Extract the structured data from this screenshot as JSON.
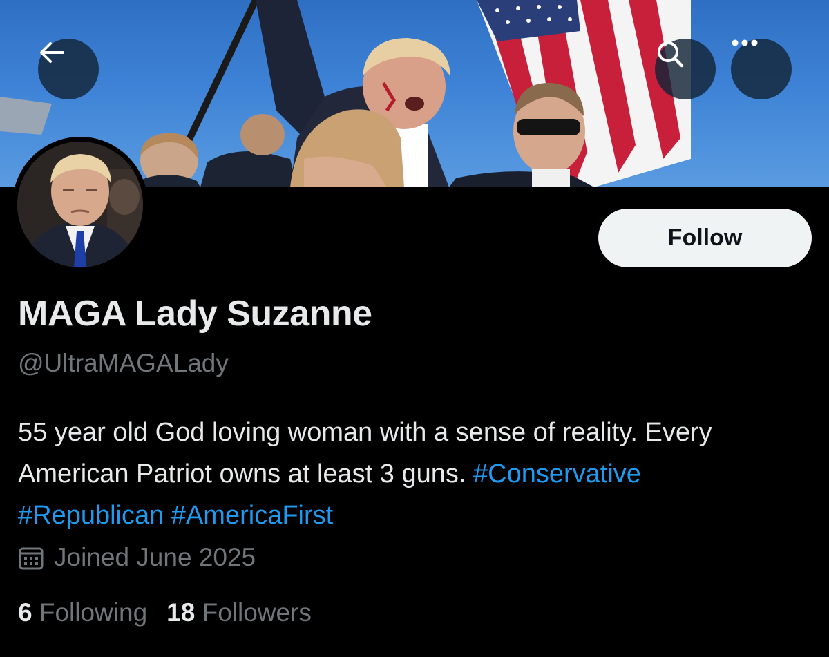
{
  "header": {
    "back_icon": "arrow-left-icon",
    "search_icon": "search-icon",
    "more_icon": "more-horizontal-icon"
  },
  "profile": {
    "display_name": "MAGA Lady Suzanne",
    "handle": "@UltraMAGALady",
    "follow_label": "Follow",
    "bio_text_1": "55 year old God loving woman with a sense of reality. Every American Patriot owns at least 3 guns. ",
    "hashtags": [
      "#Conservative",
      "#Republican",
      "#AmericaFirst"
    ],
    "joined": "Joined June 2025",
    "following_count": "6",
    "following_label": "Following",
    "followers_count": "18",
    "followers_label": "Followers"
  },
  "colors": {
    "background": "#000000",
    "primary_text": "#e7e9ea",
    "secondary_text": "#71767b",
    "link": "#1d9bf0",
    "follow_button_bg": "#eff3f4"
  }
}
